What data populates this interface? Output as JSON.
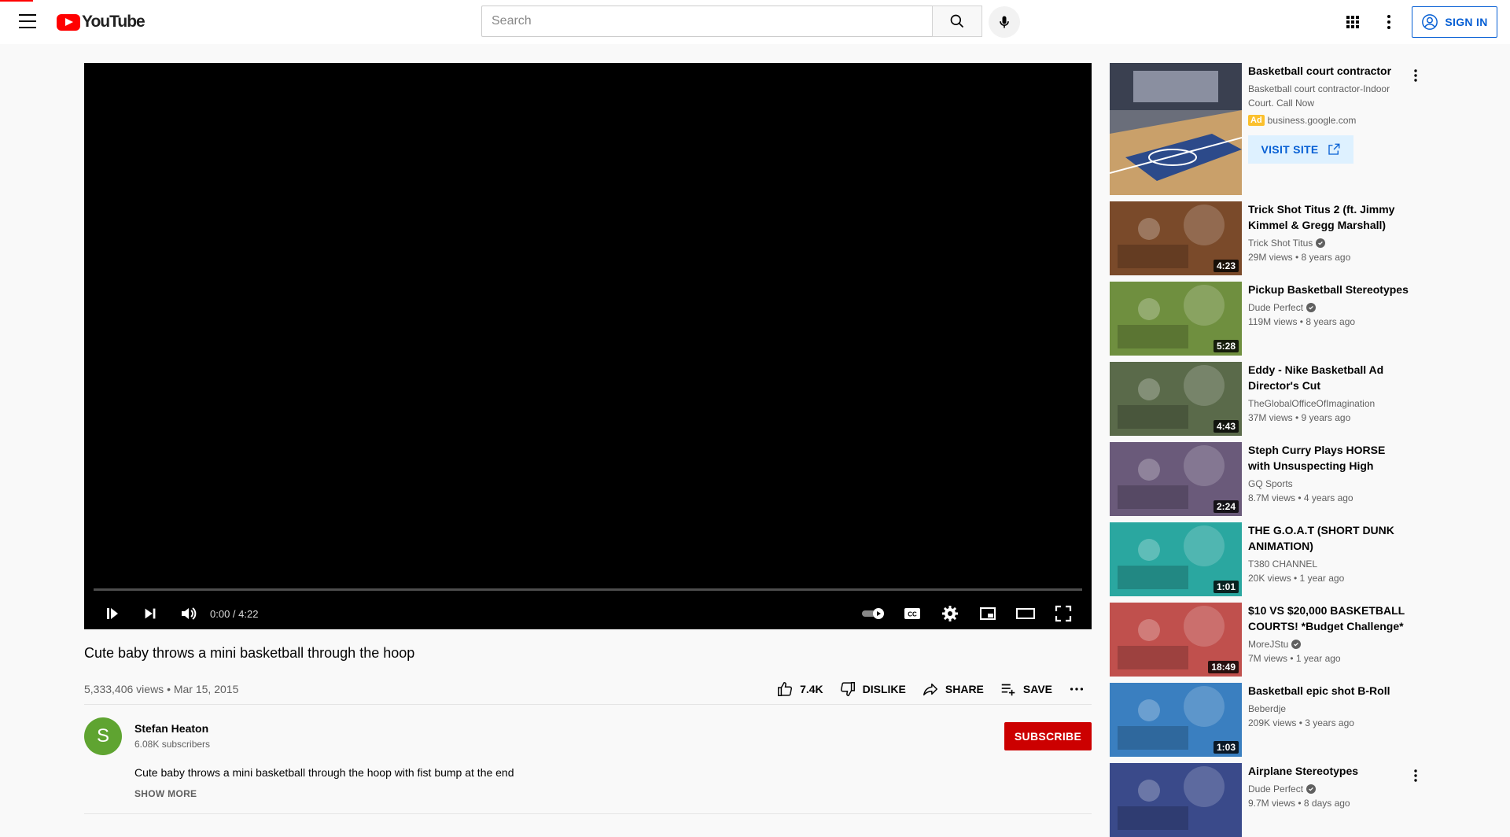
{
  "header": {
    "logo_text": "YouTube",
    "search_placeholder": "Search",
    "sign_in_label": "SIGN IN"
  },
  "player": {
    "time": "0:00 / 4:22"
  },
  "video": {
    "title": "Cute baby throws a mini basketball through the hoop",
    "views_date": "5,333,406 views • Mar 15, 2015",
    "likes": "7.4K",
    "dislike_label": "DISLIKE",
    "share_label": "SHARE",
    "save_label": "SAVE"
  },
  "owner": {
    "avatar_letter": "S",
    "name": "Stefan Heaton",
    "subscribers": "6.08K subscribers",
    "subscribe_label": "SUBSCRIBE",
    "description": "Cute baby throws a mini basketball through the hoop with fist bump at the end",
    "show_more": "SHOW MORE"
  },
  "ad": {
    "title": "Basketball court contractor",
    "description": "Basketball court contractor-Indoor Court. Call Now",
    "badge": "Ad",
    "domain": "business.google.com",
    "button_label": "VISIT SITE"
  },
  "recommendations": [
    {
      "title": "Trick Shot Titus 2 (ft. Jimmy Kimmel & Gregg Marshall)",
      "channel": "Trick Shot Titus",
      "verified": true,
      "stats": "29M views • 8 years ago",
      "duration": "4:23",
      "color": "#7a4a2a"
    },
    {
      "title": "Pickup Basketball Stereotypes",
      "channel": "Dude Perfect",
      "verified": true,
      "stats": "119M views • 8 years ago",
      "duration": "5:28",
      "color": "#6f8f3f"
    },
    {
      "title": "Eddy - Nike Basketball Ad Director's Cut",
      "channel": "TheGlobalOfficeOfImagination",
      "verified": false,
      "stats": "37M views • 9 years ago",
      "duration": "4:43",
      "color": "#5a6a4a"
    },
    {
      "title": "Steph Curry Plays HORSE with Unsuspecting High Schoolers |...",
      "channel": "GQ Sports",
      "verified": false,
      "stats": "8.7M views • 4 years ago",
      "duration": "2:24",
      "color": "#6a5a7a"
    },
    {
      "title": "THE G.O.A.T (SHORT DUNK ANIMATION)",
      "channel": "T380 CHANNEL",
      "verified": false,
      "stats": "20K views • 1 year ago",
      "duration": "1:01",
      "color": "#2aa7a0"
    },
    {
      "title": "$10 VS $20,000 BASKETBALL COURTS! *Budget Challenge*",
      "channel": "MoreJStu",
      "verified": true,
      "stats": "7M views • 1 year ago",
      "duration": "18:49",
      "color": "#c0504d"
    },
    {
      "title": "Basketball epic shot B-Roll",
      "channel": "Beberdje",
      "verified": false,
      "stats": "209K views • 3 years ago",
      "duration": "1:03",
      "color": "#3a7fc0"
    },
    {
      "title": "Airplane Stereotypes",
      "channel": "Dude Perfect",
      "verified": true,
      "stats": "9.7M views • 8 days ago",
      "duration": "",
      "color": "#3a4a8a"
    }
  ]
}
